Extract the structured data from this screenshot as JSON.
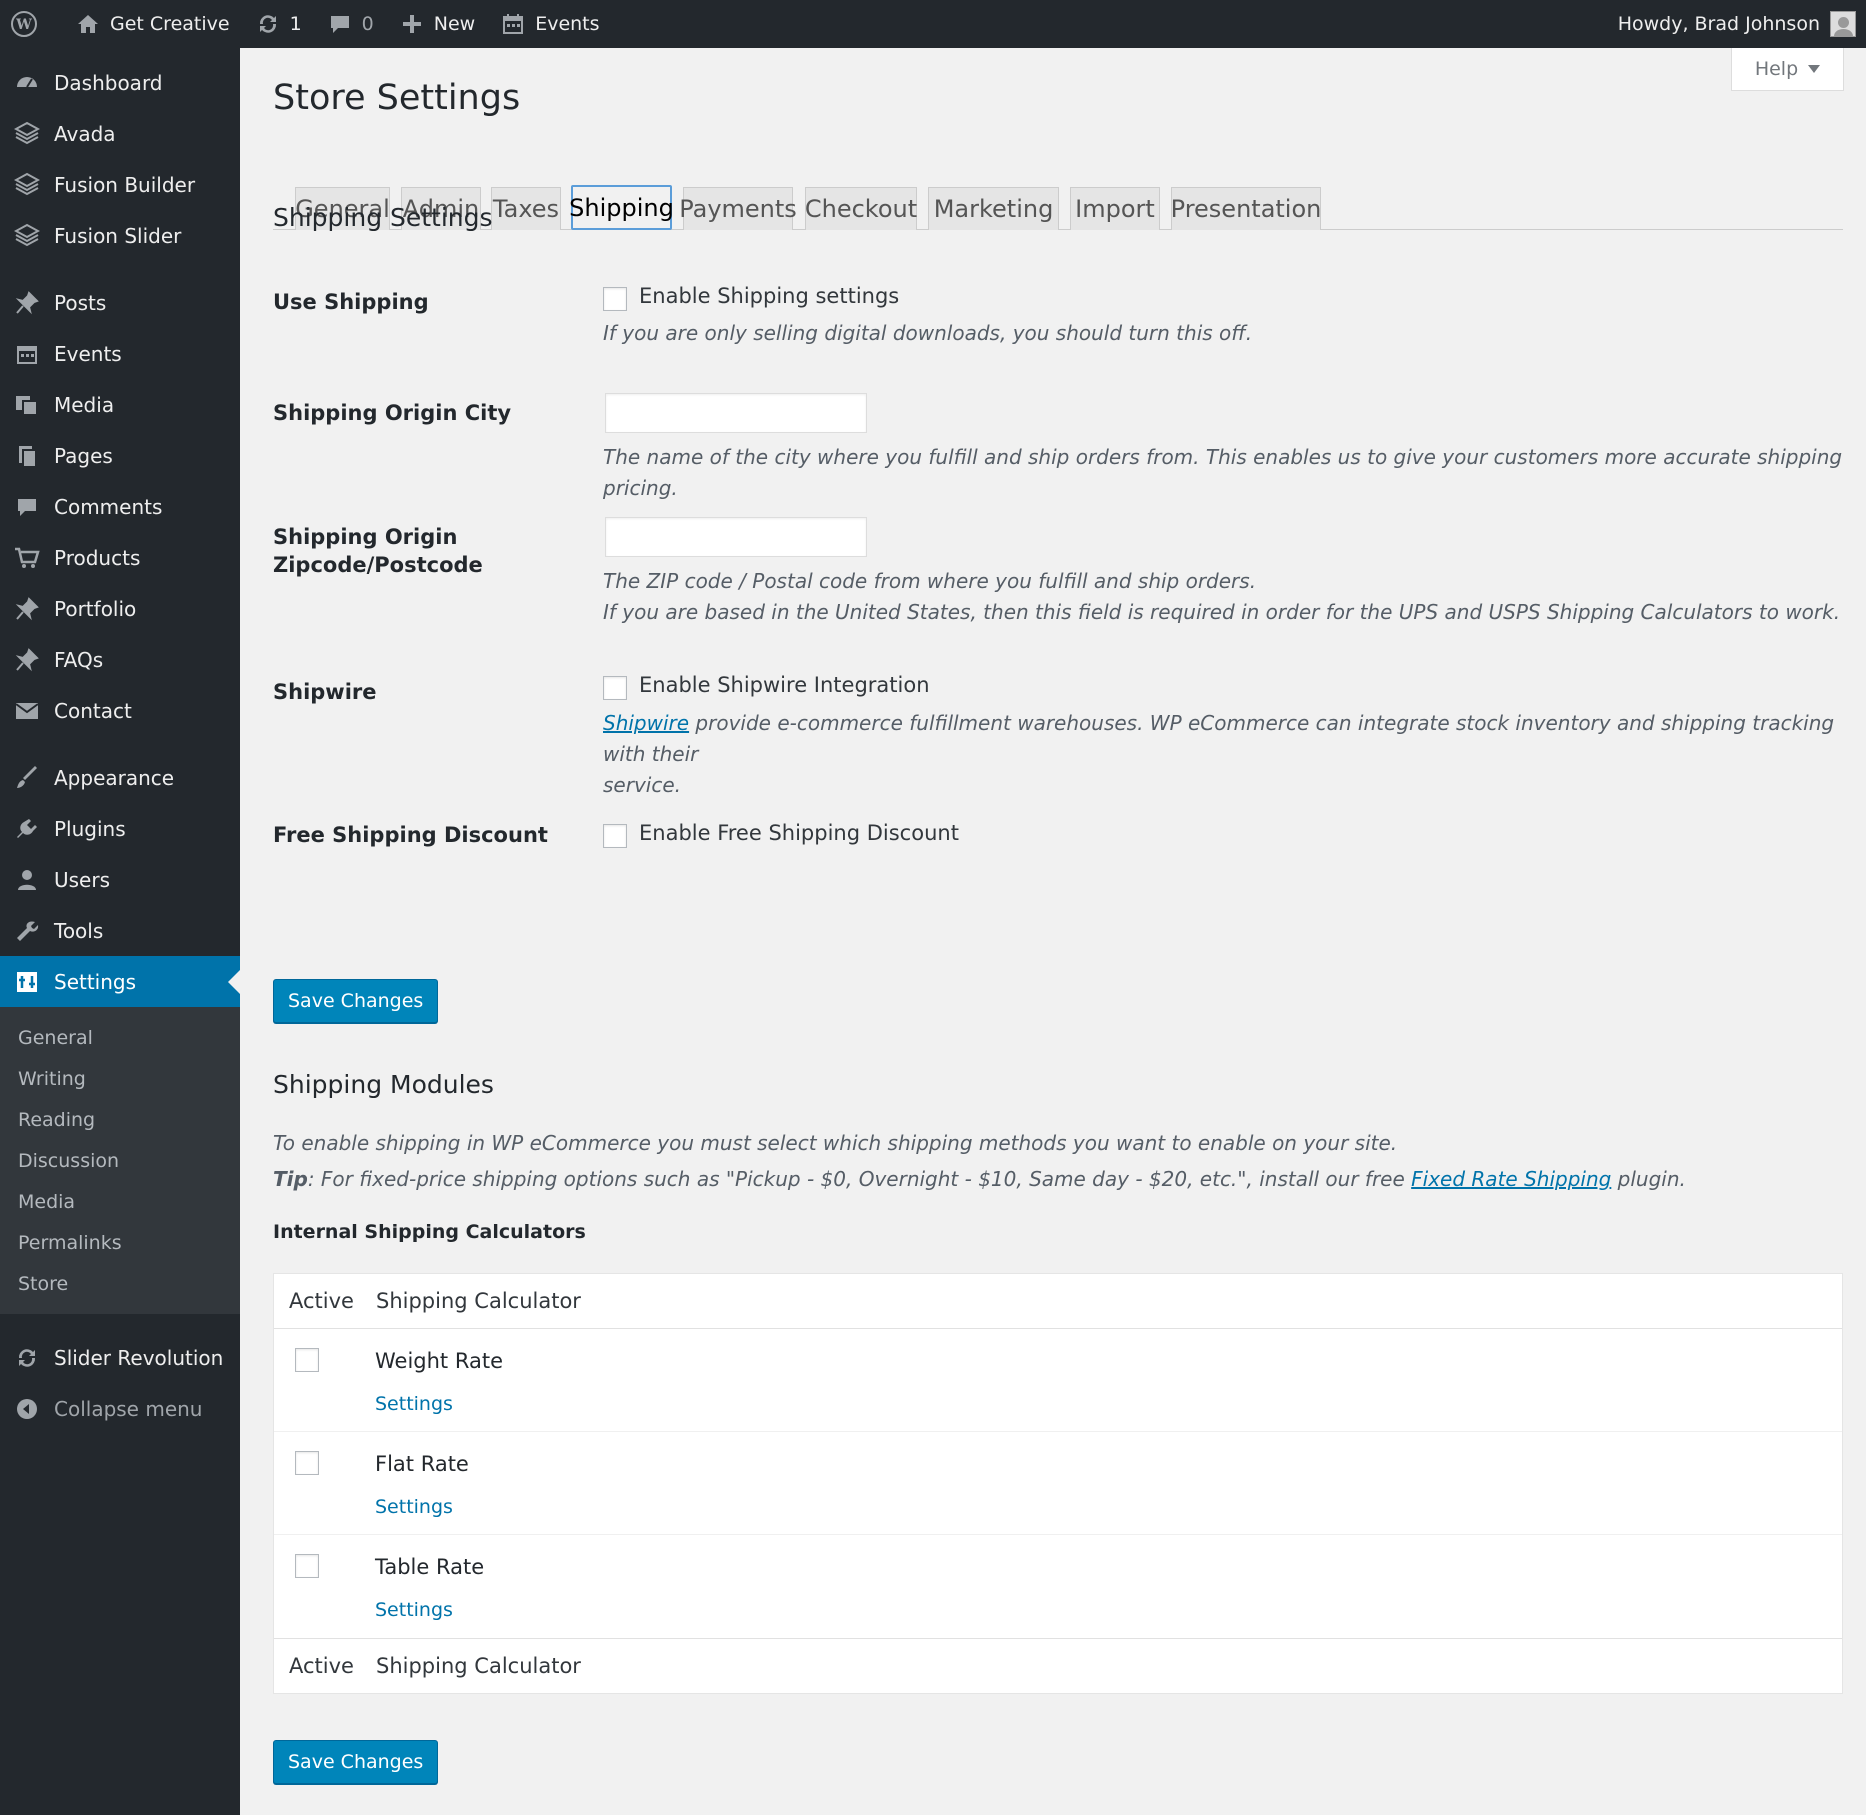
{
  "admin_bar": {
    "site_name": "Get Creative",
    "updates_count": "1",
    "comments_count": "0",
    "new_label": "New",
    "events_label": "Events",
    "greeting": "Howdy, Brad Johnson"
  },
  "sidebar": {
    "items": [
      {
        "label": "Dashboard",
        "icon": "dashboard-icon"
      },
      {
        "label": "Avada",
        "icon": "avada-icon"
      },
      {
        "label": "Fusion Builder",
        "icon": "fusion-builder-icon"
      },
      {
        "label": "Fusion Slider",
        "icon": "fusion-slider-icon"
      },
      {
        "label": "Posts",
        "icon": "pin-icon"
      },
      {
        "label": "Events",
        "icon": "calendar-icon"
      },
      {
        "label": "Media",
        "icon": "media-icon"
      },
      {
        "label": "Pages",
        "icon": "pages-icon"
      },
      {
        "label": "Comments",
        "icon": "comment-icon"
      },
      {
        "label": "Products",
        "icon": "cart-icon"
      },
      {
        "label": "Portfolio",
        "icon": "pin-icon"
      },
      {
        "label": "FAQs",
        "icon": "pin-icon"
      },
      {
        "label": "Contact",
        "icon": "mail-icon"
      },
      {
        "label": "Appearance",
        "icon": "brush-icon"
      },
      {
        "label": "Plugins",
        "icon": "plug-icon"
      },
      {
        "label": "Users",
        "icon": "user-icon"
      },
      {
        "label": "Tools",
        "icon": "wrench-icon"
      },
      {
        "label": "Settings",
        "icon": "settings-icon"
      }
    ],
    "submenu": [
      "General",
      "Writing",
      "Reading",
      "Discussion",
      "Media",
      "Permalinks",
      "Store"
    ],
    "slider_revolution": "Slider Revolution",
    "collapse": "Collapse menu",
    "accent_color": "#0073aa"
  },
  "page": {
    "title": "Store Settings",
    "help": "Help",
    "tabs": [
      "General",
      "Admin",
      "Taxes",
      "Shipping",
      "Payments",
      "Checkout",
      "Marketing",
      "Import",
      "Presentation"
    ],
    "active_tab": "Shipping"
  },
  "shipping_settings": {
    "heading": "Shipping Settings",
    "use_shipping": {
      "label": "Use Shipping",
      "checkbox_label": "Enable Shipping settings",
      "checked": false,
      "desc": "If you are only selling digital downloads, you should turn this off."
    },
    "origin_city": {
      "label": "Shipping Origin City",
      "value": "",
      "desc": "The name of the city where you fulfill and ship orders from. This enables us to give your customers more accurate shipping pricing."
    },
    "origin_zip": {
      "label_line1": "Shipping Origin",
      "label_line2": "Zipcode/Postcode",
      "value": "",
      "desc_line1": "The ZIP code / Postal code from where you fulfill and ship orders.",
      "desc_line2": "If you are based in the United States, then this field is required in order for the UPS and USPS Shipping Calculators to work."
    },
    "shipwire": {
      "label": "Shipwire",
      "checkbox_label": "Enable Shipwire Integration",
      "checked": false,
      "link": "Shipwire",
      "desc_line1": " provide e-commerce fulfillment warehouses. WP eCommerce can integrate stock inventory and shipping tracking with their",
      "desc_line2": "service."
    },
    "free_shipping": {
      "label": "Free Shipping Discount",
      "checkbox_label": "Enable Free Shipping Discount",
      "checked": false
    },
    "save": "Save Changes"
  },
  "shipping_modules": {
    "heading": "Shipping Modules",
    "intro": "To enable shipping in WP eCommerce you must select which shipping methods you want to enable on your site.",
    "tip_label": "Tip",
    "tip_text": ": For fixed-price shipping options such as \"Pickup - $0, Overnight - $10, Same day - $20, etc.\", install our free ",
    "tip_link": "Fixed Rate Shipping",
    "tip_end": " plugin.",
    "internal_heading": "Internal Shipping Calculators",
    "columns": {
      "active": "Active",
      "name": "Shipping Calculator"
    },
    "calculators": [
      {
        "name": "Weight Rate",
        "settings": "Settings",
        "active": false
      },
      {
        "name": "Flat Rate",
        "settings": "Settings",
        "active": false
      },
      {
        "name": "Table Rate",
        "settings": "Settings",
        "active": false
      }
    ],
    "save": "Save Changes"
  }
}
